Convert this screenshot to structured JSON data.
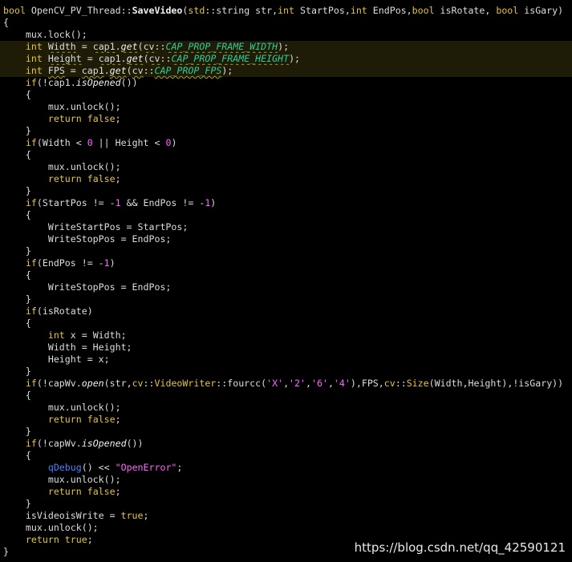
{
  "code_lines": [
    [
      [
        "kw",
        "bool"
      ],
      [
        "t",
        " "
      ],
      [
        "t",
        "OpenCV_PV_Thread"
      ],
      [
        "t",
        "::"
      ],
      [
        "fn",
        "SaveVideo"
      ],
      [
        "t",
        "("
      ],
      [
        "ns",
        "std"
      ],
      [
        "t",
        "::"
      ],
      [
        "t",
        "string str,"
      ],
      [
        "kw",
        "int"
      ],
      [
        "t",
        " StartPos,"
      ],
      [
        "kw",
        "int"
      ],
      [
        "t",
        " EndPos,"
      ],
      [
        "kw",
        "bool"
      ],
      [
        "t",
        " isRotate, "
      ],
      [
        "kw",
        "bool"
      ],
      [
        "t",
        " isGary)"
      ]
    ],
    [
      [
        "t",
        "{"
      ]
    ],
    [
      [
        "t",
        "    mux.lock();"
      ]
    ],
    [
      [
        "t",
        "    "
      ],
      [
        "kw",
        "int"
      ],
      [
        "t",
        " "
      ],
      [
        "w",
        "Width"
      ],
      [
        "t",
        " = "
      ],
      [
        "w",
        "cap1"
      ],
      [
        "t",
        "."
      ],
      [
        "wm",
        "get"
      ],
      [
        "t",
        "("
      ],
      [
        "w",
        "cv"
      ],
      [
        "t",
        "::"
      ],
      [
        "wc",
        "CAP_PROP_FRAME_WIDTH"
      ],
      [
        "t",
        ");"
      ]
    ],
    [
      [
        "t",
        "    "
      ],
      [
        "kw",
        "int"
      ],
      [
        "t",
        " "
      ],
      [
        "w",
        "Height"
      ],
      [
        "t",
        " = "
      ],
      [
        "w",
        "cap1"
      ],
      [
        "t",
        "."
      ],
      [
        "wm",
        "get"
      ],
      [
        "t",
        "("
      ],
      [
        "w",
        "cv"
      ],
      [
        "t",
        "::"
      ],
      [
        "wc",
        "CAP_PROP_FRAME_HEIGHT"
      ],
      [
        "t",
        ");"
      ]
    ],
    [
      [
        "t",
        "    "
      ],
      [
        "kw",
        "int"
      ],
      [
        "t",
        " "
      ],
      [
        "w",
        "FPS"
      ],
      [
        "t",
        " = "
      ],
      [
        "w",
        "cap1"
      ],
      [
        "t",
        "."
      ],
      [
        "wm",
        "get"
      ],
      [
        "t",
        "("
      ],
      [
        "w",
        "cv"
      ],
      [
        "t",
        "::"
      ],
      [
        "wc",
        "CAP_PROP_FPS"
      ],
      [
        "t",
        ");"
      ]
    ],
    [
      [
        "t",
        "    "
      ],
      [
        "kw",
        "if"
      ],
      [
        "t",
        "(!cap1."
      ],
      [
        "mem",
        "isOpened"
      ],
      [
        "t",
        "())"
      ]
    ],
    [
      [
        "t",
        "    {"
      ]
    ],
    [
      [
        "t",
        "        mux.unlock();"
      ]
    ],
    [
      [
        "t",
        "        "
      ],
      [
        "kw",
        "return"
      ],
      [
        "t",
        " "
      ],
      [
        "kw",
        "false"
      ],
      [
        "t",
        ";"
      ]
    ],
    [
      [
        "t",
        "    }"
      ]
    ],
    [
      [
        "t",
        "    "
      ],
      [
        "kw",
        "if"
      ],
      [
        "t",
        "(Width < "
      ],
      [
        "num",
        "0"
      ],
      [
        "t",
        " || Height < "
      ],
      [
        "num",
        "0"
      ],
      [
        "t",
        ")"
      ]
    ],
    [
      [
        "t",
        "    {"
      ]
    ],
    [
      [
        "t",
        "        mux.unlock();"
      ]
    ],
    [
      [
        "t",
        "        "
      ],
      [
        "kw",
        "return"
      ],
      [
        "t",
        " "
      ],
      [
        "kw",
        "false"
      ],
      [
        "t",
        ";"
      ]
    ],
    [
      [
        "t",
        "    }"
      ]
    ],
    [
      [
        "t",
        "    "
      ],
      [
        "kw",
        "if"
      ],
      [
        "t",
        "(StartPos != -"
      ],
      [
        "num",
        "1"
      ],
      [
        "t",
        " && EndPos != -"
      ],
      [
        "num",
        "1"
      ],
      [
        "t",
        ")"
      ]
    ],
    [
      [
        "t",
        "    {"
      ]
    ],
    [
      [
        "t",
        "        WriteStartPos = StartPos;"
      ]
    ],
    [
      [
        "t",
        "        WriteStopPos = EndPos;"
      ]
    ],
    [
      [
        "t",
        "    }"
      ]
    ],
    [
      [
        "t",
        "    "
      ],
      [
        "kw",
        "if"
      ],
      [
        "t",
        "(EndPos != -"
      ],
      [
        "num",
        "1"
      ],
      [
        "t",
        ")"
      ]
    ],
    [
      [
        "t",
        "    {"
      ]
    ],
    [
      [
        "t",
        "        WriteStopPos = EndPos;"
      ]
    ],
    [
      [
        "t",
        "    }"
      ]
    ],
    [
      [
        "t",
        "    "
      ],
      [
        "kw",
        "if"
      ],
      [
        "t",
        "(isRotate)"
      ]
    ],
    [
      [
        "t",
        "    {"
      ]
    ],
    [
      [
        "t",
        "        "
      ],
      [
        "kw",
        "int"
      ],
      [
        "t",
        " x = Width;"
      ]
    ],
    [
      [
        "t",
        "        Width = Height;"
      ]
    ],
    [
      [
        "t",
        "        Height = x;"
      ]
    ],
    [
      [
        "t",
        "    }"
      ]
    ],
    [
      [
        "t",
        "    "
      ],
      [
        "kw",
        "if"
      ],
      [
        "t",
        "(!capWv."
      ],
      [
        "mem",
        "open"
      ],
      [
        "t",
        "(str,"
      ],
      [
        "ns",
        "cv"
      ],
      [
        "t",
        "::"
      ],
      [
        "ns",
        "VideoWriter"
      ],
      [
        "t",
        "::fourcc("
      ],
      [
        "str",
        "'X'"
      ],
      [
        "t",
        ","
      ],
      [
        "str",
        "'2'"
      ],
      [
        "t",
        ","
      ],
      [
        "str",
        "'6'"
      ],
      [
        "t",
        ","
      ],
      [
        "str",
        "'4'"
      ],
      [
        "t",
        "),FPS,"
      ],
      [
        "ns",
        "cv"
      ],
      [
        "t",
        "::"
      ],
      [
        "ns",
        "Size"
      ],
      [
        "t",
        "(Width,Height),!isGary))"
      ]
    ],
    [
      [
        "t",
        "    {"
      ]
    ],
    [
      [
        "t",
        "        mux.unlock();"
      ]
    ],
    [
      [
        "t",
        "        "
      ],
      [
        "kw",
        "return"
      ],
      [
        "t",
        " "
      ],
      [
        "kw",
        "false"
      ],
      [
        "t",
        ";"
      ]
    ],
    [
      [
        "t",
        "    }"
      ]
    ],
    [
      [
        "t",
        "    "
      ],
      [
        "kw",
        "if"
      ],
      [
        "t",
        "(!capWv."
      ],
      [
        "mem",
        "isOpened"
      ],
      [
        "t",
        "())"
      ]
    ],
    [
      [
        "t",
        "    {"
      ]
    ],
    [
      [
        "t",
        "        "
      ],
      [
        "blue",
        "qDebug"
      ],
      [
        "t",
        "() << "
      ],
      [
        "str",
        "\"OpenError\""
      ],
      [
        "t",
        ";"
      ]
    ],
    [
      [
        "t",
        "        mux.unlock();"
      ]
    ],
    [
      [
        "t",
        "        "
      ],
      [
        "kw",
        "return"
      ],
      [
        "t",
        " "
      ],
      [
        "kw",
        "false"
      ],
      [
        "t",
        ";"
      ]
    ],
    [
      [
        "t",
        "    }"
      ]
    ],
    [
      [
        "t",
        "    isVideoisWrite = "
      ],
      [
        "kw",
        "true"
      ],
      [
        "t",
        ";"
      ]
    ],
    [
      [
        "t",
        "    mux.unlock();"
      ]
    ],
    [
      [
        "t",
        "    "
      ],
      [
        "kw",
        "return"
      ],
      [
        "t",
        " "
      ],
      [
        "kw",
        "true"
      ],
      [
        "t",
        ";"
      ]
    ],
    [
      [
        "t",
        "}"
      ]
    ]
  ],
  "highlighted_lines": [
    3,
    4,
    5
  ],
  "watermark": "https://blog.csdn.net/qq_42590121",
  "colors": {
    "background": "#000000",
    "keyword": "#e6c43c",
    "text": "#dddddd",
    "number": "#ff66ff",
    "constant": "#33cc99",
    "blue_call": "#4a82ff"
  }
}
